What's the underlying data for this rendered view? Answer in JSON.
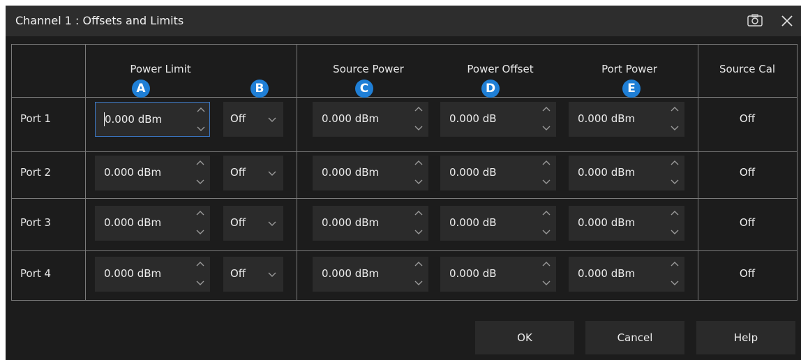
{
  "dialog": {
    "title": "Channel 1 : Offsets and Limits"
  },
  "icons": {
    "snapshot": "camera-icon",
    "close": "close-icon"
  },
  "headers": {
    "power_limit": "Power Limit",
    "source_power": "Source Power",
    "power_offset": "Power Offset",
    "port_power": "Port Power",
    "source_cal": "Source Cal"
  },
  "badges": {
    "a": "A",
    "b": "B",
    "c": "C",
    "d": "D",
    "e": "E"
  },
  "colors": {
    "badge": "#1f7fd6",
    "background": "#1c1c1c",
    "field": "#2b2b2b",
    "focus": "#3b78c4"
  },
  "rows": [
    {
      "port": "Port 1",
      "power_limit": "0.000 dBm",
      "limit_state": "Off",
      "source_power": "0.000 dBm",
      "power_offset": "0.000 dB",
      "port_power": "0.000 dBm",
      "source_cal": "Off"
    },
    {
      "port": "Port 2",
      "power_limit": "0.000 dBm",
      "limit_state": "Off",
      "source_power": "0.000 dBm",
      "power_offset": "0.000 dB",
      "port_power": "0.000 dBm",
      "source_cal": "Off"
    },
    {
      "port": "Port 3",
      "power_limit": "0.000 dBm",
      "limit_state": "Off",
      "source_power": "0.000 dBm",
      "power_offset": "0.000 dB",
      "port_power": "0.000 dBm",
      "source_cal": "Off"
    },
    {
      "port": "Port 4",
      "power_limit": "0.000 dBm",
      "limit_state": "Off",
      "source_power": "0.000 dBm",
      "power_offset": "0.000 dB",
      "port_power": "0.000 dBm",
      "source_cal": "Off"
    }
  ],
  "buttons": {
    "ok": "OK",
    "cancel": "Cancel",
    "help": "Help"
  }
}
